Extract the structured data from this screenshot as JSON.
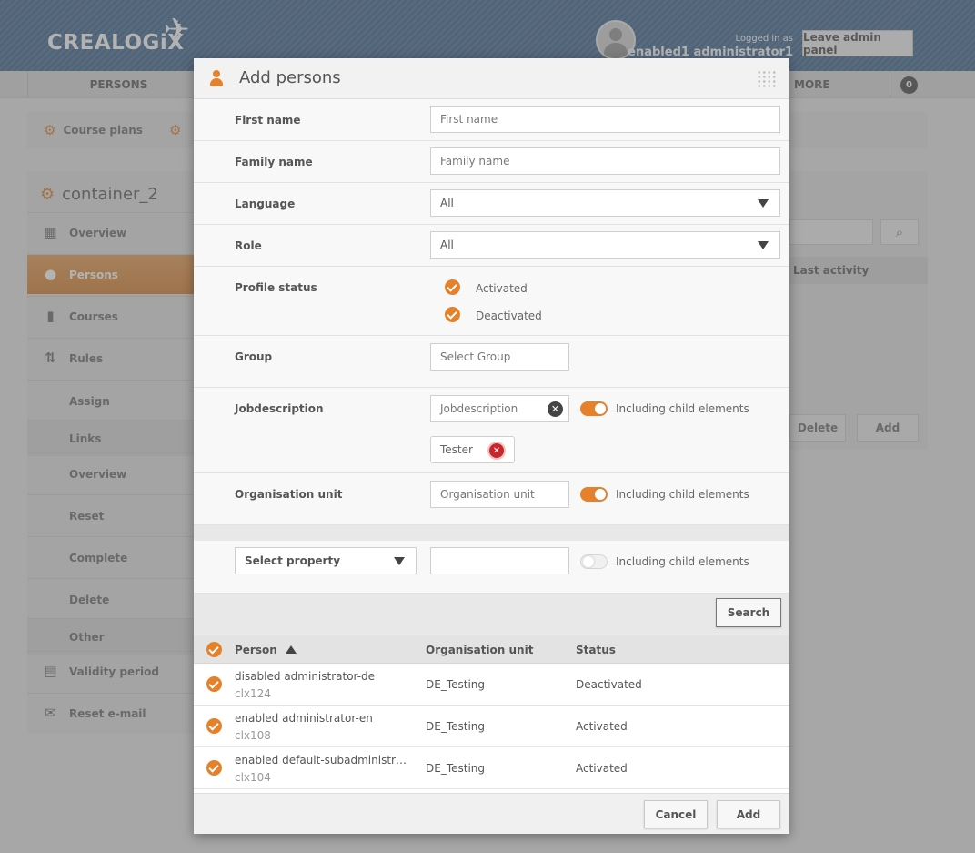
{
  "header": {
    "logo_text": "CREALOGiX",
    "logged_in_label": "Logged in as",
    "user_name": "enabled1 administrator1",
    "leave_admin_label": "Leave admin panel"
  },
  "nav": {
    "persons": "PERSONS",
    "more": "MORE",
    "count": "0"
  },
  "breadcrumb": {
    "item1": "Course plans"
  },
  "sidebar": {
    "title": "container_2",
    "items": [
      {
        "label": "Overview",
        "icon": "grid-icon"
      },
      {
        "label": "Persons",
        "icon": "person-icon",
        "active": true
      },
      {
        "label": "Courses",
        "icon": "book-icon"
      },
      {
        "label": "Rules",
        "icon": "rules-icon"
      },
      {
        "label": "Assign"
      },
      {
        "label": "Links"
      },
      {
        "label": "Overview"
      },
      {
        "label": "Reset"
      },
      {
        "label": "Complete"
      },
      {
        "label": "Delete"
      },
      {
        "label": "Other"
      },
      {
        "label": "Validity period",
        "icon": "calendar-icon"
      },
      {
        "label": "Reset e-mail",
        "icon": "mail-icon"
      }
    ]
  },
  "right_panel": {
    "column": "Last activity",
    "delete_label": "Delete",
    "add_label": "Add"
  },
  "modal": {
    "title": "Add persons",
    "first_name": {
      "label": "First name",
      "placeholder": "First name"
    },
    "family_name": {
      "label": "Family name",
      "placeholder": "Family name"
    },
    "language": {
      "label": "Language",
      "value": "All"
    },
    "role": {
      "label": "Role",
      "value": "All"
    },
    "profile_status": {
      "label": "Profile status",
      "options": [
        "Activated",
        "Deactivated"
      ]
    },
    "group": {
      "label": "Group",
      "placeholder": "Select Group"
    },
    "jobdescription": {
      "label": "Jobdescription",
      "placeholder": "Jobdescription",
      "tag": "Tester",
      "child_label": "Including child elements"
    },
    "org_unit": {
      "label": "Organisation unit",
      "placeholder": "Organisation unit",
      "child_label": "Including child elements"
    },
    "property": {
      "placeholder": "Select property",
      "child_label": "Including child elements"
    },
    "search_label": "Search",
    "table": {
      "headers": {
        "person": "Person",
        "org_unit": "Organisation unit",
        "status": "Status"
      },
      "rows": [
        {
          "name": "disabled administrator-de",
          "login": "clx124",
          "org_unit": "DE_Testing",
          "status": "Deactivated"
        },
        {
          "name": "enabled administrator-en",
          "login": "clx108",
          "org_unit": "DE_Testing",
          "status": "Activated"
        },
        {
          "name": "enabled default-subadministrator-en",
          "login": "clx104",
          "org_unit": "DE_Testing",
          "status": "Activated"
        }
      ]
    },
    "cancel_label": "Cancel",
    "add_label": "Add"
  },
  "colors": {
    "accent": "#e4812a",
    "header_blue": "#557aa0"
  }
}
